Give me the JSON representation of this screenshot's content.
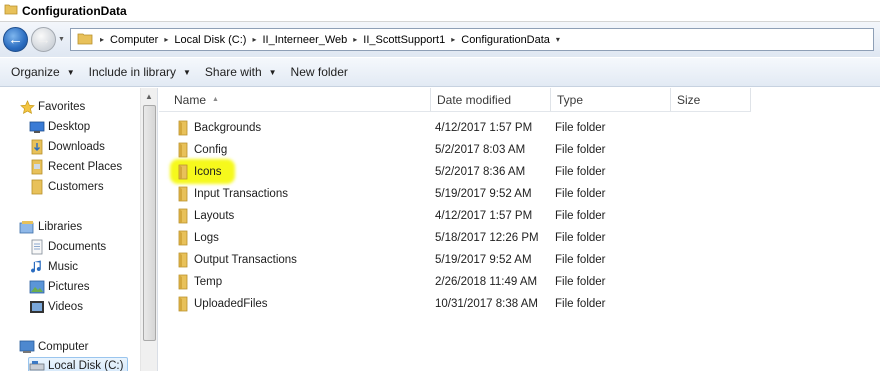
{
  "window": {
    "title": "ConfigurationData"
  },
  "address": {
    "breadcrumbs": [
      "Computer",
      "Local Disk (C:)",
      "II_Interneer_Web",
      "II_ScottSupport1",
      "ConfigurationData"
    ]
  },
  "toolbar": {
    "organize": "Organize",
    "include_in_library": "Include in library",
    "share_with": "Share with",
    "new_folder": "New folder"
  },
  "nav": {
    "favorites_label": "Favorites",
    "favorites": [
      "Desktop",
      "Downloads",
      "Recent Places",
      "Customers"
    ],
    "libraries_label": "Libraries",
    "libraries": [
      "Documents",
      "Music",
      "Pictures",
      "Videos"
    ],
    "computer_label": "Computer",
    "drives": [
      "Local Disk (C:)"
    ]
  },
  "columns": {
    "name": "Name",
    "date": "Date modified",
    "type": "Type",
    "size": "Size"
  },
  "files": [
    {
      "name": "Backgrounds",
      "date": "4/12/2017 1:57 PM",
      "type": "File folder"
    },
    {
      "name": "Config",
      "date": "5/2/2017 8:03 AM",
      "type": "File folder"
    },
    {
      "name": "Icons",
      "date": "5/2/2017 8:36 AM",
      "type": "File folder"
    },
    {
      "name": "Input Transactions",
      "date": "5/19/2017 9:52 AM",
      "type": "File folder"
    },
    {
      "name": "Layouts",
      "date": "4/12/2017 1:57 PM",
      "type": "File folder"
    },
    {
      "name": "Logs",
      "date": "5/18/2017 12:26 PM",
      "type": "File folder"
    },
    {
      "name": "Output Transactions",
      "date": "5/19/2017 9:52 AM",
      "type": "File folder"
    },
    {
      "name": "Temp",
      "date": "2/26/2018 11:49 AM",
      "type": "File folder"
    },
    {
      "name": "UploadedFiles",
      "date": "10/31/2017 8:38 AM",
      "type": "File folder"
    }
  ],
  "highlight_color": "#f6f91c",
  "folder_color": "#e8c15a"
}
